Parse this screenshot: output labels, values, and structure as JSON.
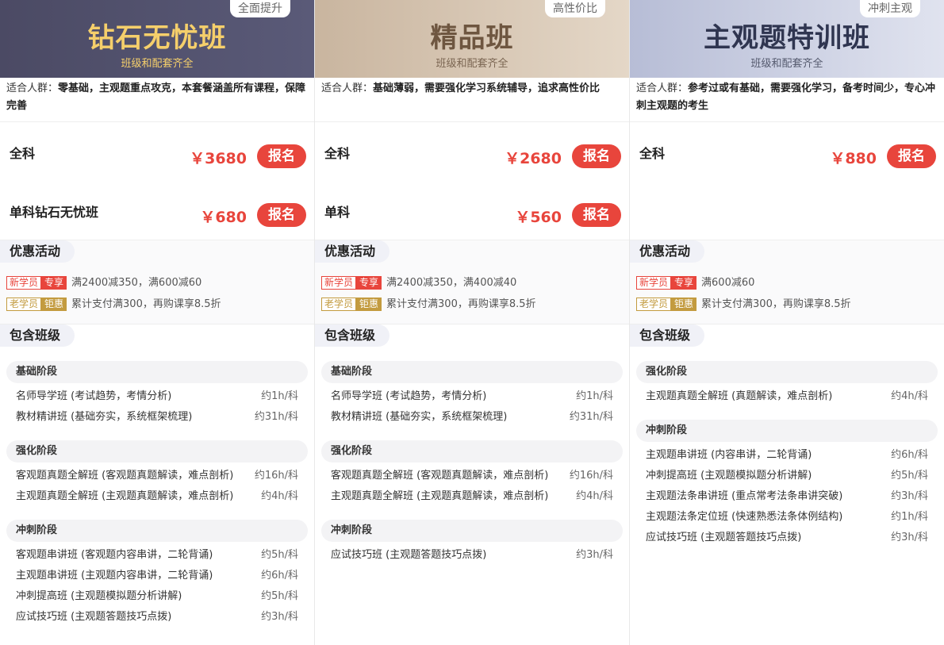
{
  "columns": [
    {
      "tag": "全面提升",
      "title": "钻石无忧班",
      "subtitle": "班级和配套齐全",
      "suit_label": "适合人群：",
      "suit_text": "零基础，主观题重点攻克，本套餐涵盖所有课程，保障完善",
      "prices": [
        {
          "name": "全科",
          "price": "￥3680",
          "button": "报名"
        },
        {
          "name": "单科钻石无忧班",
          "price": "￥680",
          "button": "报名"
        }
      ],
      "promo_title": "优惠活动",
      "promo": [
        {
          "a": "新学员",
          "b": "专享",
          "text": "满2400减350，满600减60"
        },
        {
          "a": "老学员",
          "b": "钜惠",
          "text": "累计支付满300，再购课享8.5折"
        }
      ],
      "include_title": "包含班级",
      "stages": [
        {
          "name": "基础阶段",
          "courses": [
            {
              "name": "名师导学班 (考试趋势，考情分析)",
              "hours": "约1h/科"
            },
            {
              "name": "教材精讲班 (基础夯实，系统框架梳理)",
              "hours": "约31h/科"
            }
          ]
        },
        {
          "name": "强化阶段",
          "courses": [
            {
              "name": "客观题真题全解班 (客观题真题解读，难点剖析)",
              "hours": "约16h/科"
            },
            {
              "name": "主观题真题全解班 (主观题真题解读，难点剖析)",
              "hours": "约4h/科"
            }
          ]
        },
        {
          "name": "冲刺阶段",
          "courses": [
            {
              "name": "客观题串讲班 (客观题内容串讲，二轮背诵)",
              "hours": "约5h/科"
            },
            {
              "name": "主观题串讲班 (主观题内容串讲，二轮背诵)",
              "hours": "约6h/科"
            },
            {
              "name": "冲刺提高班 (主观题模拟题分析讲解)",
              "hours": "约5h/科"
            },
            {
              "name": "应试技巧班 (主观题答题技巧点拨)",
              "hours": "约3h/科"
            }
          ]
        }
      ]
    },
    {
      "tag": "高性价比",
      "title": "精品班",
      "subtitle": "班级和配套齐全",
      "suit_label": "适合人群：",
      "suit_text": "基础薄弱，需要强化学习系统辅导，追求高性价比",
      "prices": [
        {
          "name": "全科",
          "price": "￥2680",
          "button": "报名"
        },
        {
          "name": "单科",
          "price": "￥560",
          "button": "报名"
        }
      ],
      "promo_title": "优惠活动",
      "promo": [
        {
          "a": "新学员",
          "b": "专享",
          "text": "满2400减350，满400减40"
        },
        {
          "a": "老学员",
          "b": "钜惠",
          "text": "累计支付满300，再购课享8.5折"
        }
      ],
      "include_title": "包含班级",
      "stages": [
        {
          "name": "基础阶段",
          "courses": [
            {
              "name": "名师导学班 (考试趋势，考情分析)",
              "hours": "约1h/科"
            },
            {
              "name": "教材精讲班 (基础夯实，系统框架梳理)",
              "hours": "约31h/科"
            }
          ]
        },
        {
          "name": "强化阶段",
          "courses": [
            {
              "name": "客观题真题全解班 (客观题真题解读，难点剖析)",
              "hours": "约16h/科"
            },
            {
              "name": "主观题真题全解班 (主观题真题解读，难点剖析)",
              "hours": "约4h/科"
            }
          ]
        },
        {
          "name": "冲刺阶段",
          "courses": [
            {
              "name": "应试技巧班 (主观题答题技巧点拨)",
              "hours": "约3h/科"
            }
          ]
        }
      ]
    },
    {
      "tag": "冲刺主观",
      "title": "主观题特训班",
      "subtitle": "班级和配套齐全",
      "suit_label": "适合人群：",
      "suit_text": "参考过或有基础，需要强化学习，备考时间少，专心冲刺主观题的考生",
      "prices": [
        {
          "name": "全科",
          "price": "￥880",
          "button": "报名"
        }
      ],
      "promo_title": "优惠活动",
      "promo": [
        {
          "a": "新学员",
          "b": "专享",
          "text": "满600减60"
        },
        {
          "a": "老学员",
          "b": "钜惠",
          "text": "累计支付满300，再购课享8.5折"
        }
      ],
      "include_title": "包含班级",
      "stages": [
        {
          "name": "强化阶段",
          "courses": [
            {
              "name": "主观题真题全解班 (真题解读，难点剖析)",
              "hours": "约4h/科"
            }
          ]
        },
        {
          "name": "冲刺阶段",
          "courses": [
            {
              "name": "主观题串讲班 (内容串讲，二轮背诵)",
              "hours": "约6h/科"
            },
            {
              "name": "冲刺提高班 (主观题模拟题分析讲解)",
              "hours": "约5h/科"
            },
            {
              "name": "主观题法条串讲班 (重点常考法条串讲突破)",
              "hours": "约3h/科"
            },
            {
              "name": "主观题法条定位班 (快速熟悉法条体例结构)",
              "hours": "约1h/科"
            },
            {
              "name": "应试技巧班 (主观题答题技巧点拨)",
              "hours": "约3h/科"
            }
          ]
        }
      ]
    }
  ],
  "colors": {
    "accent_red": "#e8453c",
    "gold": "#c39b3f",
    "diamond_title": "#f5cf6b"
  }
}
